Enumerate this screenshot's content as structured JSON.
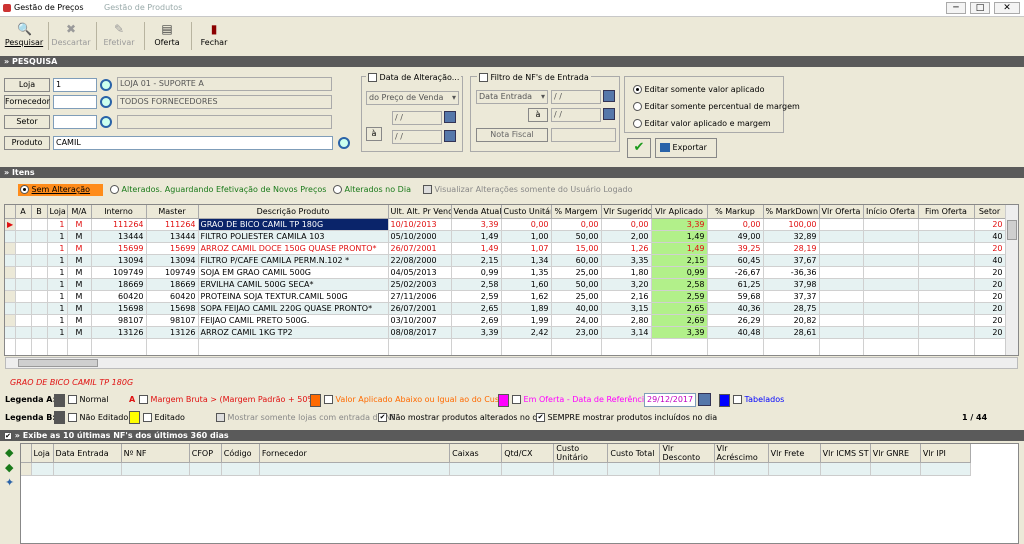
{
  "window": {
    "title": "Gestão de Preços",
    "subtitle": "Gestão de Produtos",
    "min": "─",
    "max": "□",
    "close": "✕"
  },
  "toolbar": [
    {
      "label": "Pesquisar",
      "icon": "search-icon",
      "glyph": "🔍",
      "enabled": true
    },
    {
      "label": "Descartar",
      "icon": "discard-icon",
      "glyph": "✖",
      "enabled": false
    },
    {
      "label": "Efetivar",
      "icon": "apply-icon",
      "glyph": "✎",
      "enabled": false
    },
    {
      "label": "Oferta",
      "icon": "offer-icon",
      "glyph": "▤",
      "enabled": true
    },
    {
      "label": "Fechar",
      "icon": "close-door-icon",
      "glyph": "▮",
      "enabled": true
    }
  ],
  "search": {
    "header": "» PESQUISA",
    "loja_label": "Loja",
    "loja_value": "1",
    "loja_desc": "LOJA 01 - SUPORTE A",
    "fornecedor_label": "Fornecedor",
    "fornecedor_value": "",
    "fornecedor_desc": "TODOS FORNECEDORES",
    "setor_label": "Setor",
    "setor_value": "",
    "setor_desc": "",
    "produto_label": "Produto",
    "produto_value": "CAMIL",
    "data_alt_label": "Data de Alteração...",
    "data_alt_select": "do Preço de Venda",
    "date1": "/ /",
    "date_to": "à",
    "date2": "/ /",
    "nf_label": "Filtro de NF's de Entrada",
    "nf_select": "Data Entrada",
    "nf_date1": "/ /",
    "nf_to": "à",
    "nf_date2": "/ /",
    "nota_fiscal_label": "Nota Fiscal",
    "radio_opts": [
      "Editar somente valor aplicado",
      "Editar somente percentual de margem",
      "Editar valor aplicado e margem"
    ],
    "export_label": "Exportar"
  },
  "itens": {
    "header": "» Itens",
    "filter_opts": [
      "Sem Alteração",
      "Alterados. Aguardando Efetivação de Novos Preços",
      "Alterados no Dia"
    ],
    "visualizar": "Visualizar Alterações somente do Usuário Logado"
  },
  "table": {
    "columns": [
      "A",
      "B",
      "Loja",
      "M/A",
      "Interno",
      "Master",
      "Descrição Produto",
      "Ult. Alt. Pr Venda",
      "Venda Atual",
      "Custo Unitário",
      "% Margem",
      "Vlr Sugerido",
      "Vlr Aplicado",
      "% Markup",
      "% MarkDown",
      "Vlr Oferta",
      "Início Oferta",
      "Fim Oferta",
      "Setor"
    ],
    "rows": [
      {
        "loja": "1",
        "ma": "M",
        "interno": "111264",
        "master": "111264",
        "desc": "GRAO DE BICO CAMIL TP 180G",
        "ult": "10/10/2013",
        "venda": "3,39",
        "custo": "0,00",
        "margem": "0,00",
        "sug": "0,00",
        "apl": "3,39",
        "markup": "0,00",
        "markdown": "100,00",
        "oferta": "",
        "ini": "",
        "fim": "",
        "setor": "20",
        "red": true,
        "sel": true
      },
      {
        "loja": "1",
        "ma": "M",
        "interno": "13444",
        "master": "13444",
        "desc": "FILTRO POLIESTER  CAMILA 103",
        "ult": "05/10/2000",
        "venda": "1,49",
        "custo": "1,00",
        "margem": "50,00",
        "sug": "2,00",
        "apl": "1,49",
        "markup": "49,00",
        "markdown": "32,89",
        "oferta": "",
        "ini": "",
        "fim": "",
        "setor": "40",
        "red": false,
        "sel": false
      },
      {
        "loja": "1",
        "ma": "M",
        "interno": "15699",
        "master": "15699",
        "desc": "ARROZ CAMIL DOCE 150G QUASE PRONTO*",
        "ult": "26/07/2001",
        "venda": "1,49",
        "custo": "1,07",
        "margem": "15,00",
        "sug": "1,26",
        "apl": "1,49",
        "markup": "39,25",
        "markdown": "28,19",
        "oferta": "",
        "ini": "",
        "fim": "",
        "setor": "20",
        "red": true,
        "sel": false
      },
      {
        "loja": "1",
        "ma": "M",
        "interno": "13094",
        "master": "13094",
        "desc": "FILTRO P/CAFE CAMILA PERM.N.102 *",
        "ult": "22/08/2000",
        "venda": "2,15",
        "custo": "1,34",
        "margem": "60,00",
        "sug": "3,35",
        "apl": "2,15",
        "markup": "60,45",
        "markdown": "37,67",
        "oferta": "",
        "ini": "",
        "fim": "",
        "setor": "40",
        "red": false,
        "sel": false
      },
      {
        "loja": "1",
        "ma": "M",
        "interno": "109749",
        "master": "109749",
        "desc": "SOJA EM GRAO CAMIL 500G",
        "ult": "04/05/2013",
        "venda": "0,99",
        "custo": "1,35",
        "margem": "25,00",
        "sug": "1,80",
        "apl": "0,99",
        "markup": "-26,67",
        "markdown": "-36,36",
        "oferta": "",
        "ini": "",
        "fim": "",
        "setor": "20",
        "red": false,
        "sel": false
      },
      {
        "loja": "1",
        "ma": "M",
        "interno": "18669",
        "master": "18669",
        "desc": "ERVILHA CAMIL 500G SECA*",
        "ult": "25/02/2003",
        "venda": "2,58",
        "custo": "1,60",
        "margem": "50,00",
        "sug": "3,20",
        "apl": "2,58",
        "markup": "61,25",
        "markdown": "37,98",
        "oferta": "",
        "ini": "",
        "fim": "",
        "setor": "20",
        "red": false,
        "sel": false
      },
      {
        "loja": "1",
        "ma": "M",
        "interno": "60420",
        "master": "60420",
        "desc": "PROTEINA SOJA TEXTUR.CAMIL 500G",
        "ult": "27/11/2006",
        "venda": "2,59",
        "custo": "1,62",
        "margem": "25,00",
        "sug": "2,16",
        "apl": "2,59",
        "markup": "59,68",
        "markdown": "37,37",
        "oferta": "",
        "ini": "",
        "fim": "",
        "setor": "20",
        "red": false,
        "sel": false
      },
      {
        "loja": "1",
        "ma": "M",
        "interno": "15698",
        "master": "15698",
        "desc": "SOPA FEIJAO CAMIL 220G QUASE PRONTO*",
        "ult": "26/07/2001",
        "venda": "2,65",
        "custo": "1,89",
        "margem": "40,00",
        "sug": "3,15",
        "apl": "2,65",
        "markup": "40,36",
        "markdown": "28,75",
        "oferta": "",
        "ini": "",
        "fim": "",
        "setor": "20",
        "red": false,
        "sel": false
      },
      {
        "loja": "1",
        "ma": "M",
        "interno": "98107",
        "master": "98107",
        "desc": "FEIJAO CAMIL PRETO 500G.",
        "ult": "03/10/2007",
        "venda": "2,69",
        "custo": "1,99",
        "margem": "24,00",
        "sug": "2,80",
        "apl": "2,69",
        "markup": "26,29",
        "markdown": "20,82",
        "oferta": "",
        "ini": "",
        "fim": "",
        "setor": "20",
        "red": false,
        "sel": false
      },
      {
        "loja": "1",
        "ma": "M",
        "interno": "13126",
        "master": "13126",
        "desc": "ARROZ CAMIL 1KG TP2",
        "ult": "08/08/2017",
        "venda": "3,39",
        "custo": "2,42",
        "margem": "23,00",
        "sug": "3,14",
        "apl": "3,39",
        "markup": "40,48",
        "markdown": "28,61",
        "oferta": "",
        "ini": "",
        "fim": "",
        "setor": "20",
        "red": false,
        "sel": false
      }
    ]
  },
  "selected_desc": "GRAO DE BICO CAMIL TP 180G",
  "legenda": {
    "a_label": "Legenda A:",
    "normal": "Normal",
    "a_mark": "A",
    "margem_bruta": "Margem Bruta > (Margem Padrão + 50%)",
    "valor_abaixo": "Valor Aplicado Abaixo ou Igual ao do Custo",
    "em_oferta": "Em Oferta - Data de Referência",
    "ref_date": "29/12/2017",
    "tabelados": "Tabelados",
    "b_label": "Legenda B:",
    "nao_editado": "Não Editado",
    "editado": "Editado",
    "mostrar_lojas": "Mostrar somente lojas com entrada de NF",
    "nao_mostrar": "Não mostrar produtos alterados no dia",
    "sempre": "SEMPRE mostrar produtos incluídos no dia",
    "page": "1 / 44",
    "colors": {
      "margem": "#ffffff",
      "valor": "#ff6a00",
      "oferta": "#ff00ff",
      "tabelado": "#0000ff",
      "naoeditado": "#555555",
      "editado": "#ffff00"
    }
  },
  "nfs": {
    "header": "» Exibe as 10 últimas NF's dos últimos 360 dias",
    "columns": [
      "Loja",
      "Data Entrada",
      "Nº NF",
      "CFOP",
      "Código",
      "Fornecedor",
      "Caixas",
      "Qtd/CX",
      "Custo Unitário",
      "Custo Total",
      "Vlr Desconto",
      "Vlr Acréscimo",
      "Vlr Frete",
      "Vlr ICMS ST",
      "Vlr GNRE",
      "Vlr IPI"
    ]
  }
}
